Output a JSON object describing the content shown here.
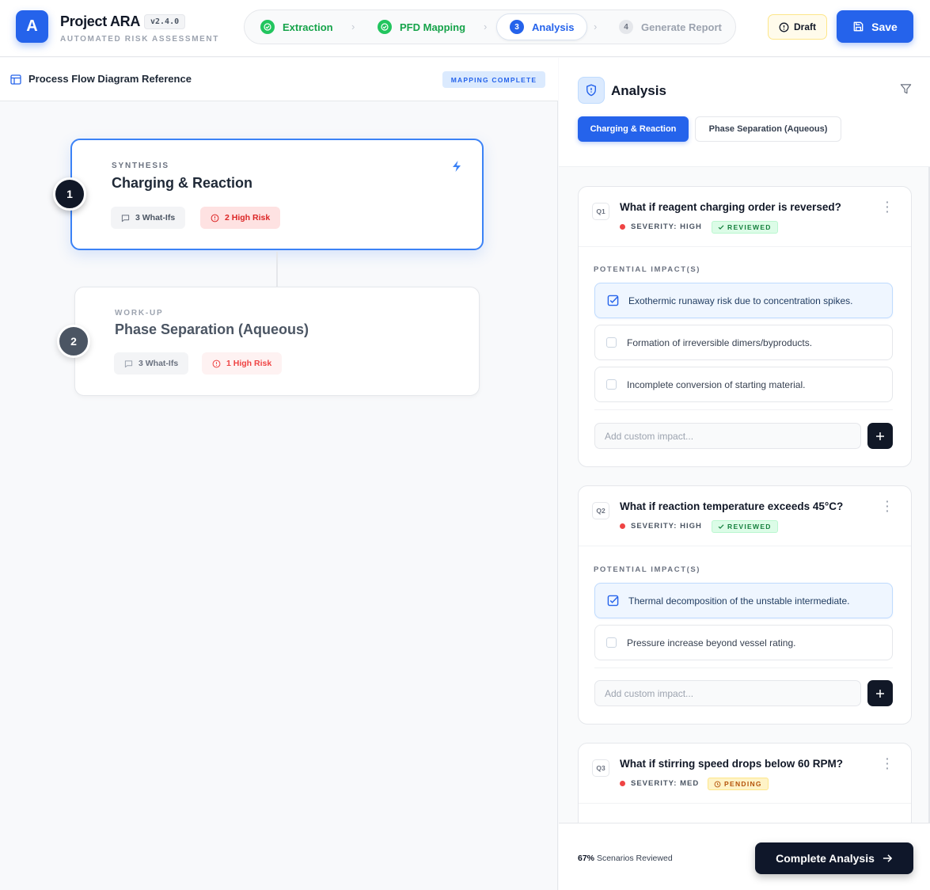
{
  "app": {
    "logo_letter": "A",
    "title": "Project ARA",
    "version": "v2.4.0",
    "subtitle": "AUTOMATED RISK ASSESSMENT"
  },
  "stepper": [
    {
      "label": "Extraction",
      "state": "done",
      "marker": ""
    },
    {
      "label": "PFD Mapping",
      "state": "done",
      "marker": ""
    },
    {
      "label": "Analysis",
      "state": "active",
      "marker": "3"
    },
    {
      "label": "Generate Report",
      "state": "todo",
      "marker": "4"
    }
  ],
  "header": {
    "draft_label": "Draft",
    "save_label": "Save"
  },
  "pfd": {
    "title": "Process Flow Diagram Reference",
    "badge": "MAPPING COMPLETE",
    "nodes": [
      {
        "number": "1",
        "stage": "SYNTHESIS",
        "title": "Charging & Reaction",
        "whatifs": "3 What-Ifs",
        "risk": "2 High Risk"
      },
      {
        "number": "2",
        "stage": "WORK-UP",
        "title": "Phase Separation (Aqueous)",
        "whatifs": "3 What-Ifs",
        "risk": "1 High Risk"
      }
    ]
  },
  "analysis": {
    "title": "Analysis",
    "tabs": [
      {
        "label": "Charging & Reaction",
        "active": true
      },
      {
        "label": "Phase Separation (Aqueous)",
        "active": false
      }
    ],
    "impact_label": "POTENTIAL IMPACT(S)",
    "add_placeholder": "Add custom impact...",
    "questions": [
      {
        "tag": "Q1",
        "text": "What if reagent charging order is reversed?",
        "severity": "SEVERITY: HIGH",
        "status": "REVIEWED",
        "impacts": [
          {
            "text": "Exothermic runaway risk due to concentration spikes.",
            "checked": true
          },
          {
            "text": "Formation of irreversible dimers/byproducts.",
            "checked": false
          },
          {
            "text": "Incomplete conversion of starting material.",
            "checked": false
          }
        ]
      },
      {
        "tag": "Q2",
        "text": "What if reaction temperature exceeds 45°C?",
        "severity": "SEVERITY: HIGH",
        "status": "REVIEWED",
        "impacts": [
          {
            "text": "Thermal decomposition of the unstable intermediate.",
            "checked": true
          },
          {
            "text": "Pressure increase beyond vessel rating.",
            "checked": false
          }
        ]
      },
      {
        "tag": "Q3",
        "text": "What if stirring speed drops below 60 RPM?",
        "severity": "SEVERITY: MED",
        "status": "PENDING",
        "impacts": []
      }
    ],
    "progress_value": "67%",
    "progress_text": "Scenarios Reviewed",
    "complete_label": "Complete Analysis"
  },
  "colors": {
    "primary": "#2563eb",
    "success": "#16a34a",
    "danger": "#ef4444",
    "warning": "#b45309",
    "dark": "#111827"
  }
}
